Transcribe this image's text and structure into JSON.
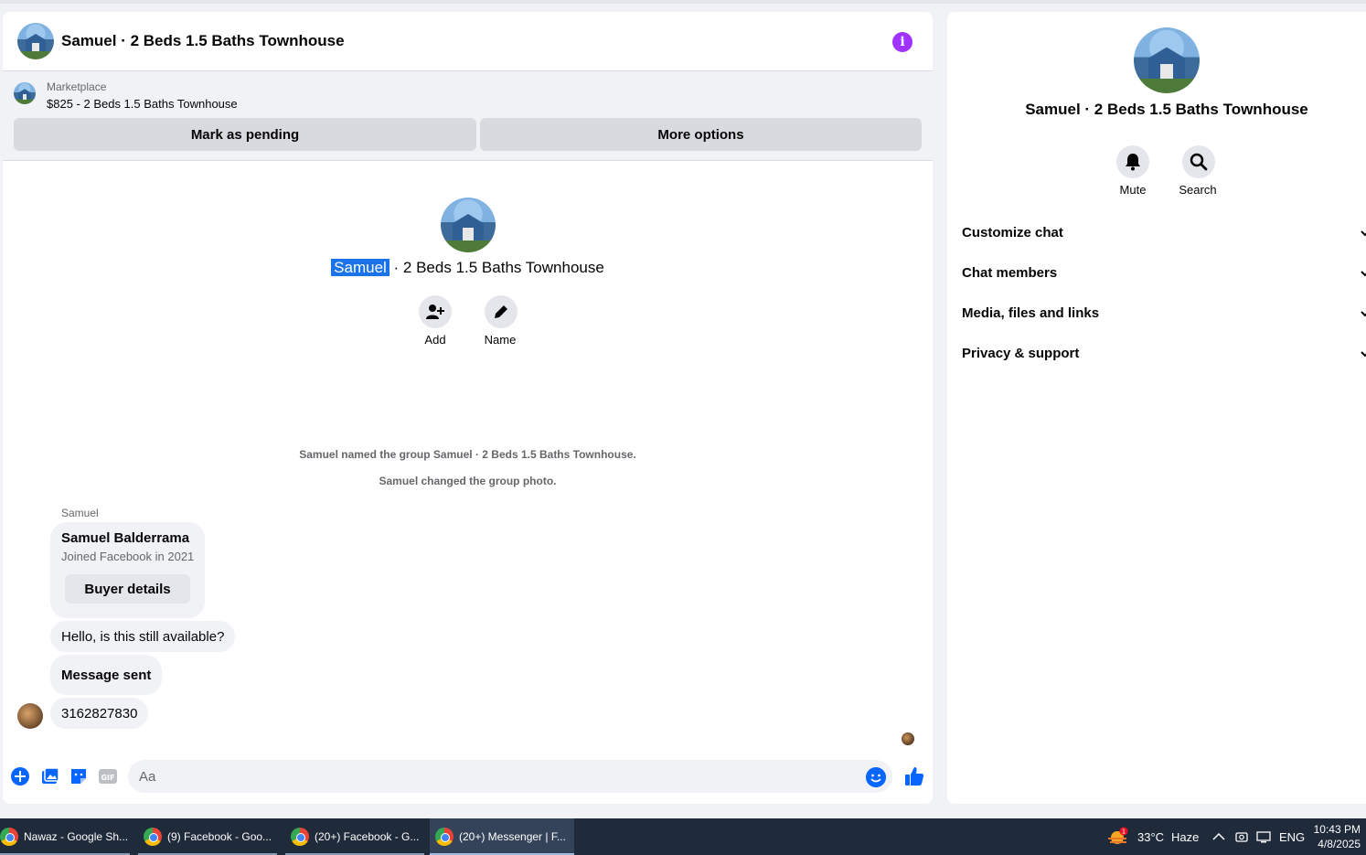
{
  "chat": {
    "title": "Samuel · 2 Beds 1.5 Baths Townhouse",
    "marketplace_label": "Marketplace",
    "listing": "$825 - 2 Beds 1.5 Baths Townhouse",
    "mark_pending_label": "Mark as pending",
    "more_options_label": "More options",
    "intro_title_highlight": "Samuel",
    "intro_title_rest": " · 2 Beds 1.5 Baths Townhouse",
    "add_label": "Add",
    "name_label": "Name",
    "system_messages": [
      "Samuel named the group Samuel · 2 Beds 1.5 Baths Townhouse.",
      "Samuel changed the group photo."
    ],
    "sender": "Samuel",
    "buyer_card": {
      "name": "Samuel Balderrama",
      "joined": "Joined Facebook in 2021",
      "button": "Buyer details"
    },
    "messages": [
      "Hello, is this still available?",
      "Message sent",
      "3162827830"
    ],
    "composer_placeholder": "Aa"
  },
  "info_panel": {
    "title": "Samuel · 2 Beds 1.5 Baths Townhouse",
    "mute_label": "Mute",
    "search_label": "Search",
    "sections": [
      "Customize chat",
      "Chat members",
      "Media, files and links",
      "Privacy & support"
    ]
  },
  "taskbar": {
    "tasks": [
      "Nawaz - Google Sh...",
      "(9) Facebook - Goo...",
      "(20+) Facebook - G...",
      "(20+) Messenger | F..."
    ],
    "weather_temp": "33°C",
    "weather_cond": "Haze",
    "weather_badge": "1",
    "language": "ENG",
    "time": "10:43 PM",
    "date": "4/8/2025"
  },
  "colors": {
    "accent": "#0866ff",
    "info": "#a033ff",
    "highlight": "#1a73e8"
  }
}
